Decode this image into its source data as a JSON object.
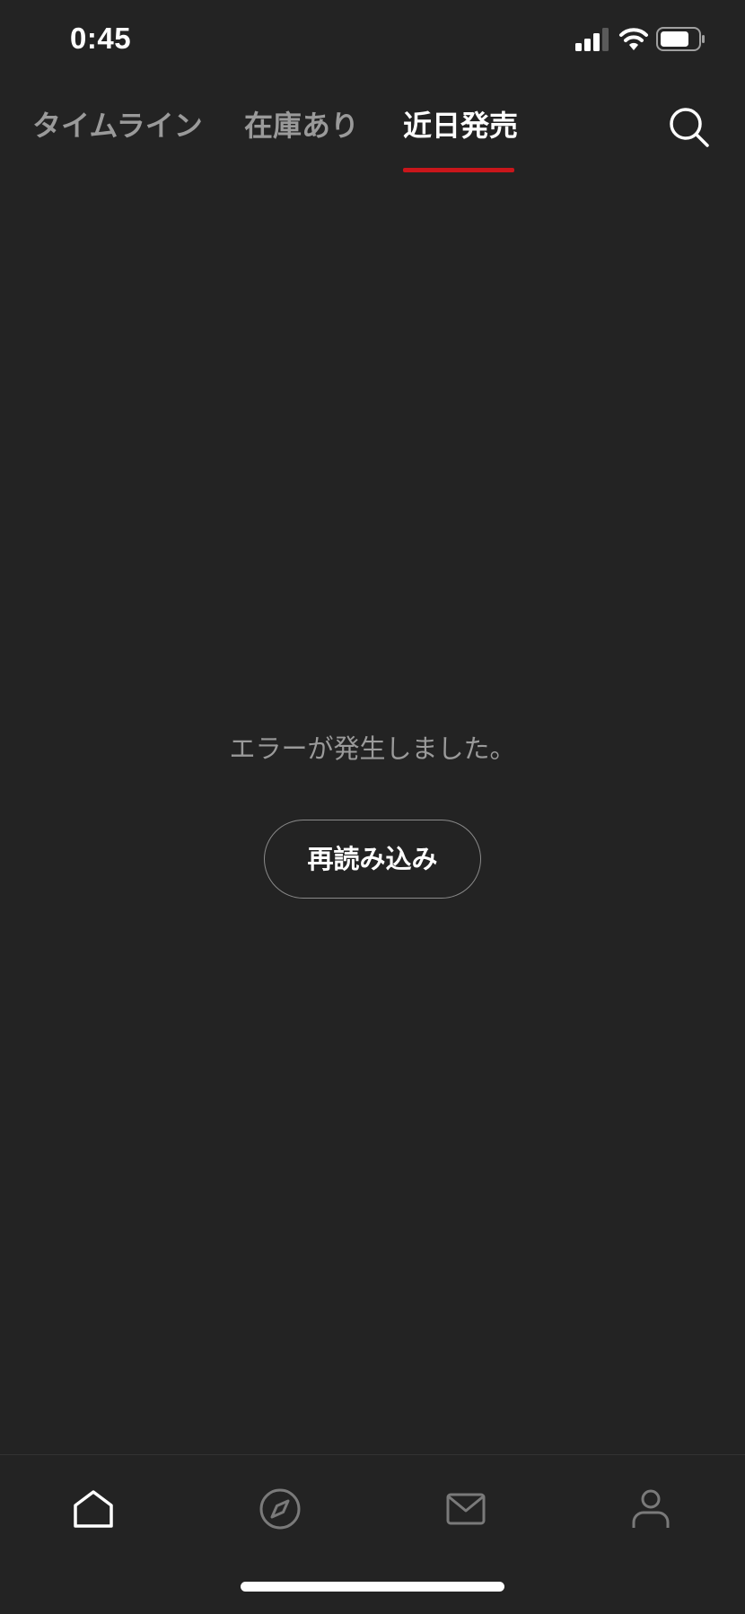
{
  "status_bar": {
    "time": "0:45",
    "icons": [
      "cellular-signal-icon",
      "wifi-icon",
      "battery-icon"
    ]
  },
  "tabs": [
    {
      "label": "タイムライン",
      "active": false
    },
    {
      "label": "在庫あり",
      "active": false
    },
    {
      "label": "近日発売",
      "active": true
    }
  ],
  "header": {
    "search_icon": "search-icon"
  },
  "content": {
    "error_message": "エラーが発生しました。",
    "reload_label": "再読み込み"
  },
  "bottom_nav": {
    "items": [
      {
        "icon": "home-icon",
        "active": true
      },
      {
        "icon": "compass-icon",
        "active": false
      },
      {
        "icon": "mail-icon",
        "active": false
      },
      {
        "icon": "person-icon",
        "active": false
      }
    ]
  },
  "colors": {
    "background": "#232323",
    "accent": "#c9161b",
    "inactive_text": "#9a9a9a",
    "active_text": "#ffffff"
  }
}
